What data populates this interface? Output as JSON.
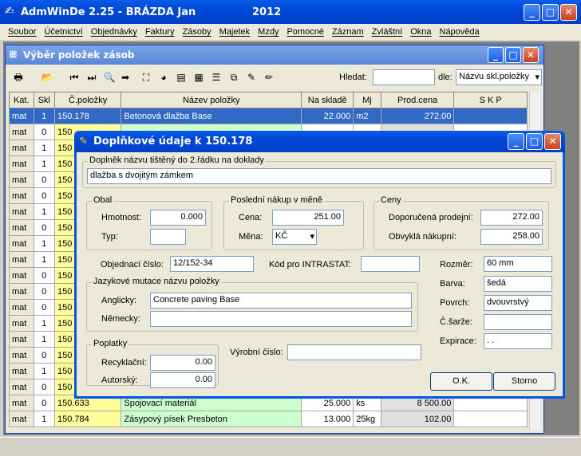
{
  "app": {
    "title": "AdmWinDe 2.25 - BRÁZDA Jan",
    "year": "2012"
  },
  "menu": [
    "Soubor",
    "Účetnictví",
    "Objednávky",
    "Faktury",
    "Zásoby",
    "Majetek",
    "Mzdy",
    "Pomocné",
    "Záznam",
    "Zvláštní",
    "Okna",
    "Nápověda"
  ],
  "child": {
    "title": "Výběr položek zásob",
    "search_label": "Hledat:",
    "search_value": "",
    "by_label": "dle:",
    "by_value": "Názvu skl.položky"
  },
  "table": {
    "headers": [
      "Kat.",
      "Skl",
      "Č.položky",
      "Název položky",
      "Na skladě",
      "Mj",
      "Prod.cena",
      "S K P"
    ],
    "rows": [
      [
        "mat",
        "1",
        "150.178",
        "Betonová dlažba Base",
        "22.000",
        "m2",
        "272.00",
        ""
      ],
      [
        "mat",
        "0",
        "150",
        "",
        "",
        "",
        "",
        ""
      ],
      [
        "mat",
        "1",
        "150",
        "",
        "",
        "",
        "",
        ""
      ],
      [
        "mat",
        "1",
        "150",
        "",
        "",
        "",
        "",
        ""
      ],
      [
        "mat",
        "0",
        "150",
        "",
        "",
        "",
        "",
        ""
      ],
      [
        "mat",
        "0",
        "150",
        "",
        "",
        "",
        "",
        ""
      ],
      [
        "mat",
        "1",
        "150",
        "",
        "",
        "",
        "",
        ""
      ],
      [
        "mat",
        "0",
        "150",
        "",
        "",
        "",
        "",
        ""
      ],
      [
        "mat",
        "1",
        "150",
        "",
        "",
        "",
        "",
        ""
      ],
      [
        "mat",
        "1",
        "150",
        "",
        "",
        "",
        "",
        ""
      ],
      [
        "mat",
        "0",
        "150",
        "",
        "",
        "",
        "",
        ""
      ],
      [
        "mat",
        "0",
        "150",
        "",
        "",
        "",
        "",
        ""
      ],
      [
        "mat",
        "0",
        "150",
        "",
        "",
        "",
        "",
        ""
      ],
      [
        "mat",
        "1",
        "150",
        "",
        "",
        "",
        "",
        ""
      ],
      [
        "mat",
        "1",
        "150",
        "",
        "",
        "",
        "",
        ""
      ],
      [
        "mat",
        "0",
        "150",
        "",
        "",
        "",
        "",
        ""
      ],
      [
        "mat",
        "1",
        "150",
        "",
        "",
        "",
        "",
        ""
      ],
      [
        "mat",
        "0",
        "150",
        "",
        "",
        "",
        "",
        ""
      ],
      [
        "mat",
        "0",
        "150.633",
        "Spojovací materiál",
        "25.000",
        "ks",
        "8 500.00",
        ""
      ],
      [
        "mat",
        "1",
        "150.784",
        "Zásypový písek Presbeton",
        "13.000",
        "25kg",
        "102.00",
        ""
      ]
    ]
  },
  "dialog": {
    "title": "Doplňkové údaje k 150.178",
    "doplnek_label": "Doplněk názvu tištěný do 2.řádku na doklady",
    "doplnek_value": "dlažba s dvojitým zámkem",
    "obal": {
      "title": "Obal",
      "hmotnost_label": "Hmotnost:",
      "hmotnost": "0.000",
      "typ_label": "Typ:",
      "typ": ""
    },
    "nakup": {
      "title": "Poslední nákup v měně",
      "cena_label": "Cena:",
      "cena": "251.00",
      "mena_label": "Měna:",
      "mena": "KČ"
    },
    "ceny": {
      "title": "Ceny",
      "doporucena_label": "Doporučená prodejní:",
      "doporucena": "272.00",
      "obvykla_label": "Obvyklá nákupní:",
      "obvykla": "258.00"
    },
    "objednaci_label": "Objednací číslo:",
    "objednaci": "12/152-34",
    "intrastat_label": "Kód pro INTRASTAT:",
    "intrastat": "",
    "mutace": {
      "title": "Jazykové mutace názvu položky",
      "anglicky_label": "Anglicky:",
      "anglicky": "Concrete paving Base",
      "nemecky_label": "Německy:",
      "nemecky": ""
    },
    "poplatky": {
      "title": "Poplatky",
      "recyklacni_label": "Recyklační:",
      "recyklacni": "0.00",
      "autorsky_label": "Autorský:",
      "autorsky": "0.00"
    },
    "vyrobni_label": "Výrobní číslo:",
    "vyrobni": "",
    "rozmer_label": "Rozměr:",
    "rozmer": "60 mm",
    "barva_label": "Barva:",
    "barva": "šedá",
    "povrch_label": "Povrch:",
    "povrch": "dvouvrstvý",
    "sarze_label": "Č.šarže:",
    "sarze": "",
    "expirace_label": "Expirace:",
    "expirace": " .  .",
    "ok_label": "O.K.",
    "storno_label": "Storno"
  }
}
